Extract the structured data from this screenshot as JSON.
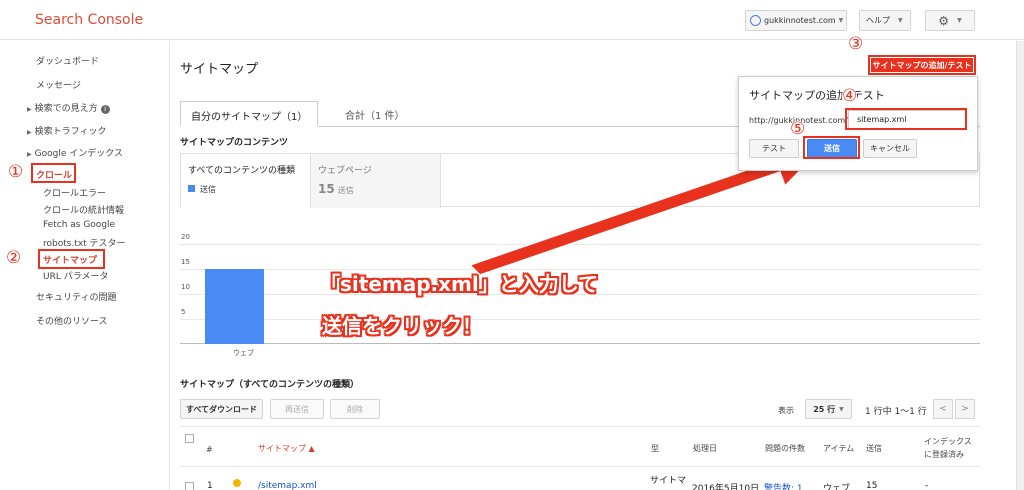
{
  "header": {
    "brand": "Search Console",
    "account": "gukkinnotest.com",
    "help": "ヘルプ"
  },
  "sidebar": {
    "items": [
      {
        "label": "ダッシュボード"
      },
      {
        "label": "メッセージ"
      },
      {
        "label": "検索での見え方"
      },
      {
        "label": "検索トラフィック"
      },
      {
        "label": "Google インデックス"
      },
      {
        "label": "クロール"
      },
      {
        "label": "クロールエラー"
      },
      {
        "label": "クロールの統計情報"
      },
      {
        "label": "Fetch as Google"
      },
      {
        "label": "robots.txt テスター"
      },
      {
        "label": "サイトマップ"
      },
      {
        "label": "URL パラメータ"
      },
      {
        "label": "セキュリティの問題"
      },
      {
        "label": "その他のリソース"
      }
    ],
    "info_glyph": "i"
  },
  "main": {
    "title": "サイトマップ",
    "tabs": [
      {
        "label": "自分のサイトマップ（1）"
      },
      {
        "label": "合計（1 件）"
      }
    ],
    "contents_heading": "サイトマップのコンテンツ",
    "content_boxes": {
      "all_label": "すべてのコンテンツの種類",
      "all_legend": "送信",
      "web_label": "ウェブページ",
      "web_value": "15",
      "web_sub": "送信"
    }
  },
  "chart_data": {
    "type": "bar",
    "categories": [
      "ウェブ"
    ],
    "series": [
      {
        "name": "送信",
        "values": [
          15
        ]
      }
    ],
    "yticks": [
      5,
      10,
      15,
      20
    ],
    "ylim": [
      0,
      20
    ],
    "color": "#4a8af4"
  },
  "annotations": {
    "markers": [
      "①",
      "②",
      "③",
      "④",
      "⑤"
    ],
    "callout_line1": "「sitemap.xml」と入力して",
    "callout_line2": "送信をクリック！",
    "color": "#e8321e"
  },
  "popup": {
    "add_test_button": "サイトマップの追加/テスト",
    "title": "サイトマップの追加/テスト",
    "url_prefix": "http://gukkinnotest.com/",
    "input_value": "sitemap.xml",
    "test_button": "テスト",
    "submit_button": "送信",
    "cancel_button": "キャンセル"
  },
  "table_section": {
    "heading": "サイトマップ（すべてのコンテンツの種類）",
    "download_all": "すべてダウンロード",
    "resubmit": "再送信",
    "delete": "削除",
    "show_label": "表示",
    "rows_select": "25 行",
    "range": "1 行中 1〜1 行",
    "prev": "<",
    "next": ">",
    "columns": [
      "#",
      "サイトマップ ▲",
      "型",
      "処理日",
      "問題の件数",
      "アイテム",
      "送信",
      "インデックス",
      "に登録済み"
    ],
    "rows": [
      {
        "num": "1",
        "sitemap": "/sitemap.xml",
        "type": "サイトマ",
        "date": "2016年5月10日",
        "issues": "警告数: 1",
        "item": "ウェブ",
        "submitted": "15",
        "indexed": "-"
      }
    ]
  }
}
